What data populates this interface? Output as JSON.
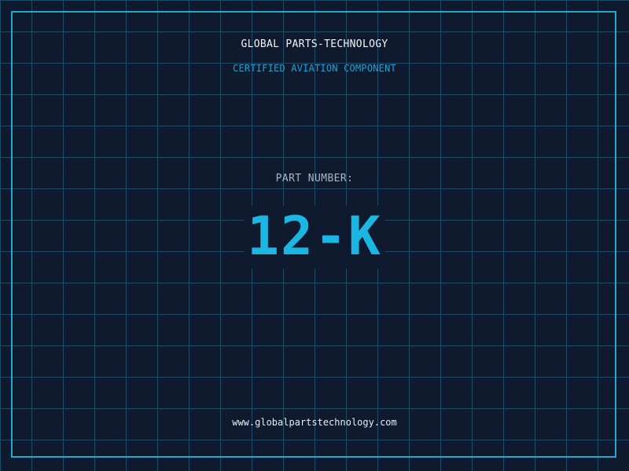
{
  "header": {
    "brand": "GLOBAL PARTS-TECHNOLOGY",
    "subtitle": "CERTIFIED AVIATION COMPONENT"
  },
  "part": {
    "label": "PART NUMBER:",
    "number": "12-K"
  },
  "footer": {
    "url": "www.globalpartstechnology.com"
  },
  "colors": {
    "background": "#0f1a2e",
    "grid": "#1d4a66",
    "accent": "#1cb6e2",
    "brand_text": "#f2f5f8",
    "label_text": "#a9b6c4"
  }
}
